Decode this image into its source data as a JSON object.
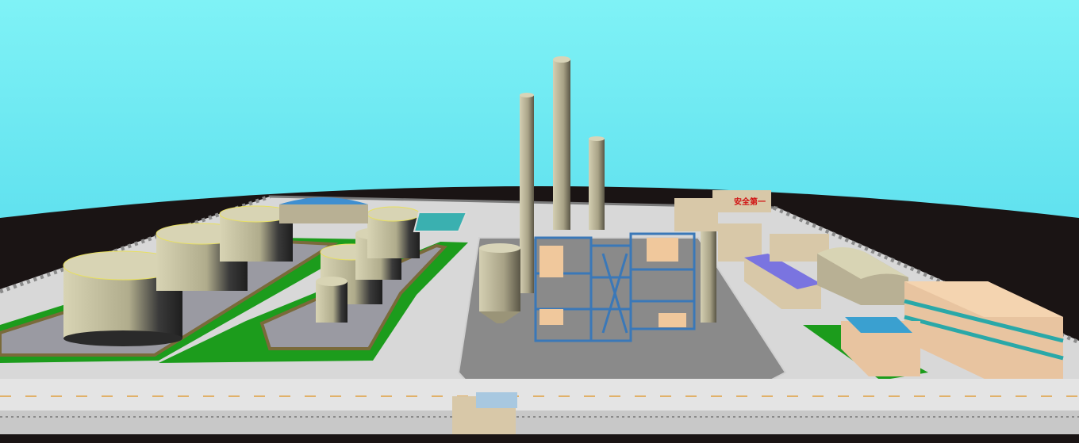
{
  "scene": {
    "description_kind": "3D rendered refinery plant model",
    "sign_text": "安全第一"
  },
  "colors": {
    "sky": "#7ff0f4",
    "horizon": "#1a1414",
    "ground": "#dcdcdc",
    "grass": "#1a9a1a",
    "tank": "#c8c4a4",
    "steel_blue": "#3a78b8",
    "column": "#b8b094"
  }
}
